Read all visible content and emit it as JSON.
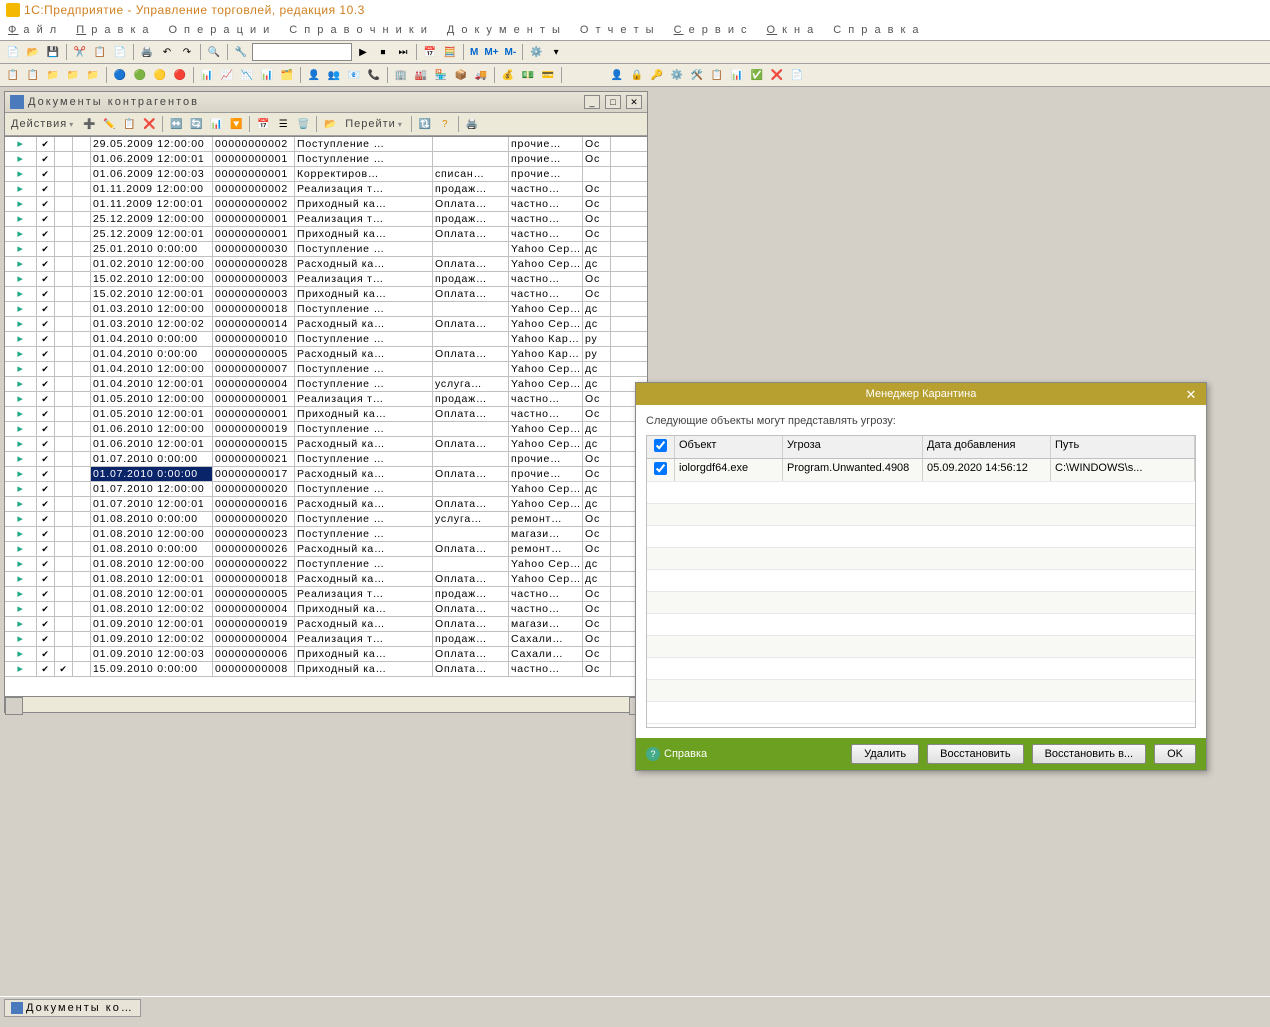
{
  "app_title": "1С:Предприятие - Управление торговлей, редакция 10.3",
  "menus": [
    "Файл",
    "Правка",
    "Операции",
    "Справочники",
    "Документы",
    "Отчеты",
    "Сервис",
    "Окна",
    "Справка"
  ],
  "doc_window": {
    "title": "Документы контрагентов",
    "actions_label": "Действия",
    "goto_label": "Перейти"
  },
  "grid_rows": [
    {
      "d": "29.05.2009 12:00:00",
      "n": "00000000002",
      "t": "Поступление …",
      "x": "",
      "p": "прочие…",
      "o": "Ос"
    },
    {
      "d": "01.06.2009 12:00:01",
      "n": "00000000001",
      "t": "Поступление …",
      "x": "",
      "p": "прочие…",
      "o": "Ос"
    },
    {
      "d": "01.06.2009 12:00:03",
      "n": "00000000001",
      "t": "Корректиров…",
      "x": "списан…",
      "p": "прочие…",
      "o": ""
    },
    {
      "d": "01.11.2009 12:00:00",
      "n": "00000000002",
      "t": "Реализация т…",
      "x": "продаж…",
      "p": "частно…",
      "o": "Ос"
    },
    {
      "d": "01.11.2009 12:00:01",
      "n": "00000000002",
      "t": "Приходный ка…",
      "x": "Оплата…",
      "p": "частно…",
      "o": "Ос"
    },
    {
      "d": "25.12.2009 12:00:00",
      "n": "00000000001",
      "t": "Реализация т…",
      "x": "продаж…",
      "p": "частно…",
      "o": "Ос"
    },
    {
      "d": "25.12.2009 12:00:01",
      "n": "00000000001",
      "t": "Приходный ка…",
      "x": "Оплата…",
      "p": "частно…",
      "o": "Ос"
    },
    {
      "d": "25.01.2010 0:00:00",
      "n": "00000000030",
      "t": "Поступление …",
      "x": "",
      "p": "Yahoo Сер…",
      "o": "дс"
    },
    {
      "d": "01.02.2010 12:00:00",
      "n": "00000000028",
      "t": "Расходный ка…",
      "x": "Оплата…",
      "p": "Yahoo Сер…",
      "o": "дс"
    },
    {
      "d": "15.02.2010 12:00:00",
      "n": "00000000003",
      "t": "Реализация т…",
      "x": "продаж…",
      "p": "частно…",
      "o": "Ос"
    },
    {
      "d": "15.02.2010 12:00:01",
      "n": "00000000003",
      "t": "Приходный ка…",
      "x": "Оплата…",
      "p": "частно…",
      "o": "Ос"
    },
    {
      "d": "01.03.2010 12:00:00",
      "n": "00000000018",
      "t": "Поступление …",
      "x": "",
      "p": "Yahoo Сер…",
      "o": "дс"
    },
    {
      "d": "01.03.2010 12:00:02",
      "n": "00000000014",
      "t": "Расходный ка…",
      "x": "Оплата…",
      "p": "Yahoo Сер…",
      "o": "дс"
    },
    {
      "d": "01.04.2010 0:00:00",
      "n": "00000000010",
      "t": "Поступление …",
      "x": "",
      "p": "Yahoo Кар…",
      "o": "ру"
    },
    {
      "d": "01.04.2010 0:00:00",
      "n": "00000000005",
      "t": "Расходный ка…",
      "x": "Оплата…",
      "p": "Yahoo Кар…",
      "o": "ру"
    },
    {
      "d": "01.04.2010 12:00:00",
      "n": "00000000007",
      "t": "Поступление …",
      "x": "",
      "p": "Yahoo Сер…",
      "o": "дс"
    },
    {
      "d": "01.04.2010 12:00:01",
      "n": "00000000004",
      "t": "Поступление …",
      "x": "услуга…",
      "p": "Yahoo Сер…",
      "o": "дс"
    },
    {
      "d": "01.05.2010 12:00:00",
      "n": "00000000001",
      "t": "Реализация т…",
      "x": "продаж…",
      "p": "частно…",
      "o": "Ос"
    },
    {
      "d": "01.05.2010 12:00:01",
      "n": "00000000001",
      "t": "Приходный ка…",
      "x": "Оплата…",
      "p": "частно…",
      "o": "Ос"
    },
    {
      "d": "01.06.2010 12:00:00",
      "n": "00000000019",
      "t": "Поступление …",
      "x": "",
      "p": "Yahoo Сер…",
      "o": "дс"
    },
    {
      "d": "01.06.2010 12:00:01",
      "n": "00000000015",
      "t": "Расходный ка…",
      "x": "Оплата…",
      "p": "Yahoo Сер…",
      "o": "дс"
    },
    {
      "d": "01.07.2010 0:00:00",
      "n": "00000000021",
      "t": "Поступление …",
      "x": "",
      "p": "прочие…",
      "o": "Ос"
    },
    {
      "d": "01.07.2010 0:00:00",
      "n": "00000000017",
      "t": "Расходный ка…",
      "x": "Оплата…",
      "p": "прочие…",
      "o": "Ос",
      "sel": true
    },
    {
      "d": "01.07.2010 12:00:00",
      "n": "00000000020",
      "t": "Поступление …",
      "x": "",
      "p": "Yahoo Сер…",
      "o": "дс"
    },
    {
      "d": "01.07.2010 12:00:01",
      "n": "00000000016",
      "t": "Расходный ка…",
      "x": "Оплата…",
      "p": "Yahoo Сер…",
      "o": "дс"
    },
    {
      "d": "01.08.2010 0:00:00",
      "n": "00000000020",
      "t": "Поступление …",
      "x": "услуга…",
      "p": "ремонт…",
      "o": "Ос"
    },
    {
      "d": "01.08.2010 12:00:00",
      "n": "00000000023",
      "t": "Поступление …",
      "x": "",
      "p": "магази…",
      "o": "Ос"
    },
    {
      "d": "01.08.2010 0:00:00",
      "n": "00000000026",
      "t": "Расходный ка…",
      "x": "Оплата…",
      "p": "ремонт…",
      "o": "Ос"
    },
    {
      "d": "01.08.2010 12:00:00",
      "n": "00000000022",
      "t": "Поступление …",
      "x": "",
      "p": "Yahoo Сер…",
      "o": "дс"
    },
    {
      "d": "01.08.2010 12:00:01",
      "n": "00000000018",
      "t": "Расходный ка…",
      "x": "Оплата…",
      "p": "Yahoo Сер…",
      "o": "дс"
    },
    {
      "d": "01.08.2010 12:00:01",
      "n": "00000000005",
      "t": "Реализация т…",
      "x": "продаж…",
      "p": "частно…",
      "o": "Ос"
    },
    {
      "d": "01.08.2010 12:00:02",
      "n": "00000000004",
      "t": "Приходный ка…",
      "x": "Оплата…",
      "p": "частно…",
      "o": "Ос"
    },
    {
      "d": "01.09.2010 12:00:01",
      "n": "00000000019",
      "t": "Расходный ка…",
      "x": "Оплата…",
      "p": "магази…",
      "o": "Ос"
    },
    {
      "d": "01.09.2010 12:00:02",
      "n": "00000000004",
      "t": "Реализация т…",
      "x": "продаж…",
      "p": "Сахали…",
      "o": "Ос"
    },
    {
      "d": "01.09.2010 12:00:03",
      "n": "00000000006",
      "t": "Приходный ка…",
      "x": "Оплата…",
      "p": "Сахали…",
      "o": "Ос"
    },
    {
      "d": "15.09.2010 0:00:00",
      "n": "00000000008",
      "t": "Приходный ка…",
      "x": "Оплата…",
      "p": "частно…",
      "o": "Ос",
      "ck2": true
    }
  ],
  "modal": {
    "title": "Менеджер Карантина",
    "message": "Следующие объекты могут представлять угрозу:",
    "cols": [
      "Объект",
      "Угроза",
      "Дата добавления",
      "Путь"
    ],
    "rows": [
      {
        "obj": "iolorgdf64.exe",
        "threat": "Program.Unwanted.4908",
        "date": "05.09.2020 14:56:12",
        "path": "C:\\WINDOWS\\s..."
      }
    ],
    "help": "Справка",
    "btn_delete": "Удалить",
    "btn_restore": "Восстановить",
    "btn_restore_to": "Восстановить в...",
    "btn_ok": "OK"
  },
  "taskbar_item": "Документы ко…"
}
